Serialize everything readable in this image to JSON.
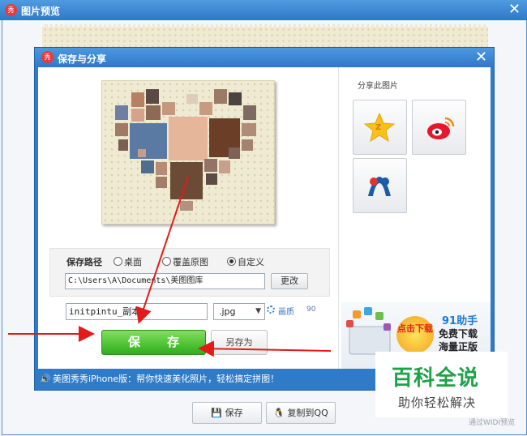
{
  "outer_window": {
    "title": "图片预览",
    "logo_text": "秀"
  },
  "dialog": {
    "title": "保存与分享",
    "logo_text": "秀",
    "save_path": {
      "label": "保存路径",
      "options": [
        "桌面",
        "覆盖原图",
        "自定义"
      ],
      "selected": "自定义",
      "path_value": "C:\\Users\\A\\Documents\\美图图库",
      "change_label": "更改"
    },
    "filename": {
      "value": "initpintu_副本",
      "extension": ".jpg",
      "quality_label": "画质",
      "quality_value": "90"
    },
    "save_label": "保 存",
    "save_as_label": "另存为",
    "share": {
      "title": "分享此图片",
      "targets": [
        "qzone-icon",
        "weibo-icon",
        "renren-icon"
      ]
    },
    "ad": {
      "brand": "91助手",
      "badge": "点击下载",
      "line1": "免费下载",
      "line2": "海量正版"
    },
    "status_text": "美图秀秀iPhone版：帮你快速美化照片，轻松搞定拼图！"
  },
  "bottom": {
    "save_label": "保存",
    "copy_label": "复制到QQ"
  },
  "watermark": {
    "big": "百科全说",
    "small": "助你轻松解决"
  },
  "footer_note": "通过WIDI预览",
  "colors": {
    "titlebar": "#2f78c8",
    "save_green": "#2fad1c",
    "arrow_red": "#e31a1a",
    "link_blue": "#3b73c4"
  }
}
